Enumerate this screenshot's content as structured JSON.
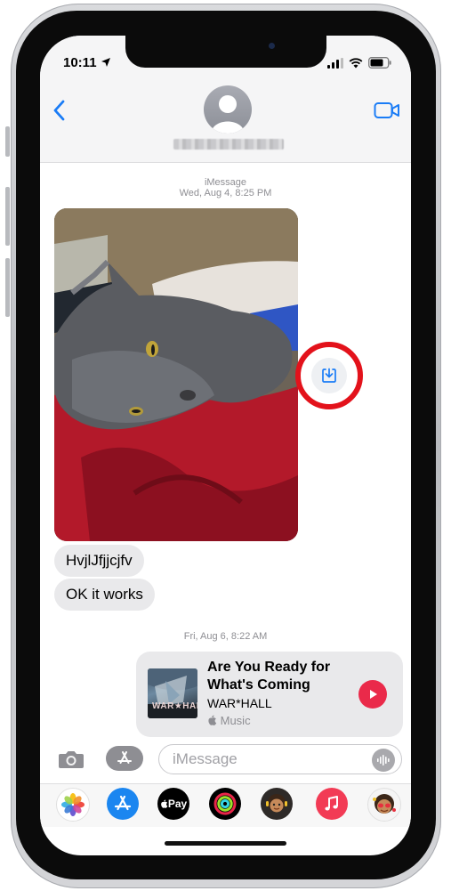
{
  "status": {
    "time": "10:11"
  },
  "conversation": {
    "service_label": "iMessage",
    "first_timestamp": "Wed, Aug 4, 8:25 PM",
    "second_timestamp": "Fri, Aug 6, 8:22 AM",
    "messages": [
      "HvjlJfjjcjfv",
      "OK it works"
    ]
  },
  "music_card": {
    "title": "Are You Ready for What's Coming",
    "artist": "WAR*HALL",
    "brand": "Music",
    "album_text": "WAR★HALL"
  },
  "composer": {
    "placeholder": "iMessage"
  },
  "app_drawer": {
    "apple_pay_label": "Pay"
  },
  "colors": {
    "ios_blue": "#1a7cf6",
    "highlight_red": "#e3121b",
    "music_red": "#ea2a4a",
    "bubble_gray": "#e9e9eb"
  }
}
